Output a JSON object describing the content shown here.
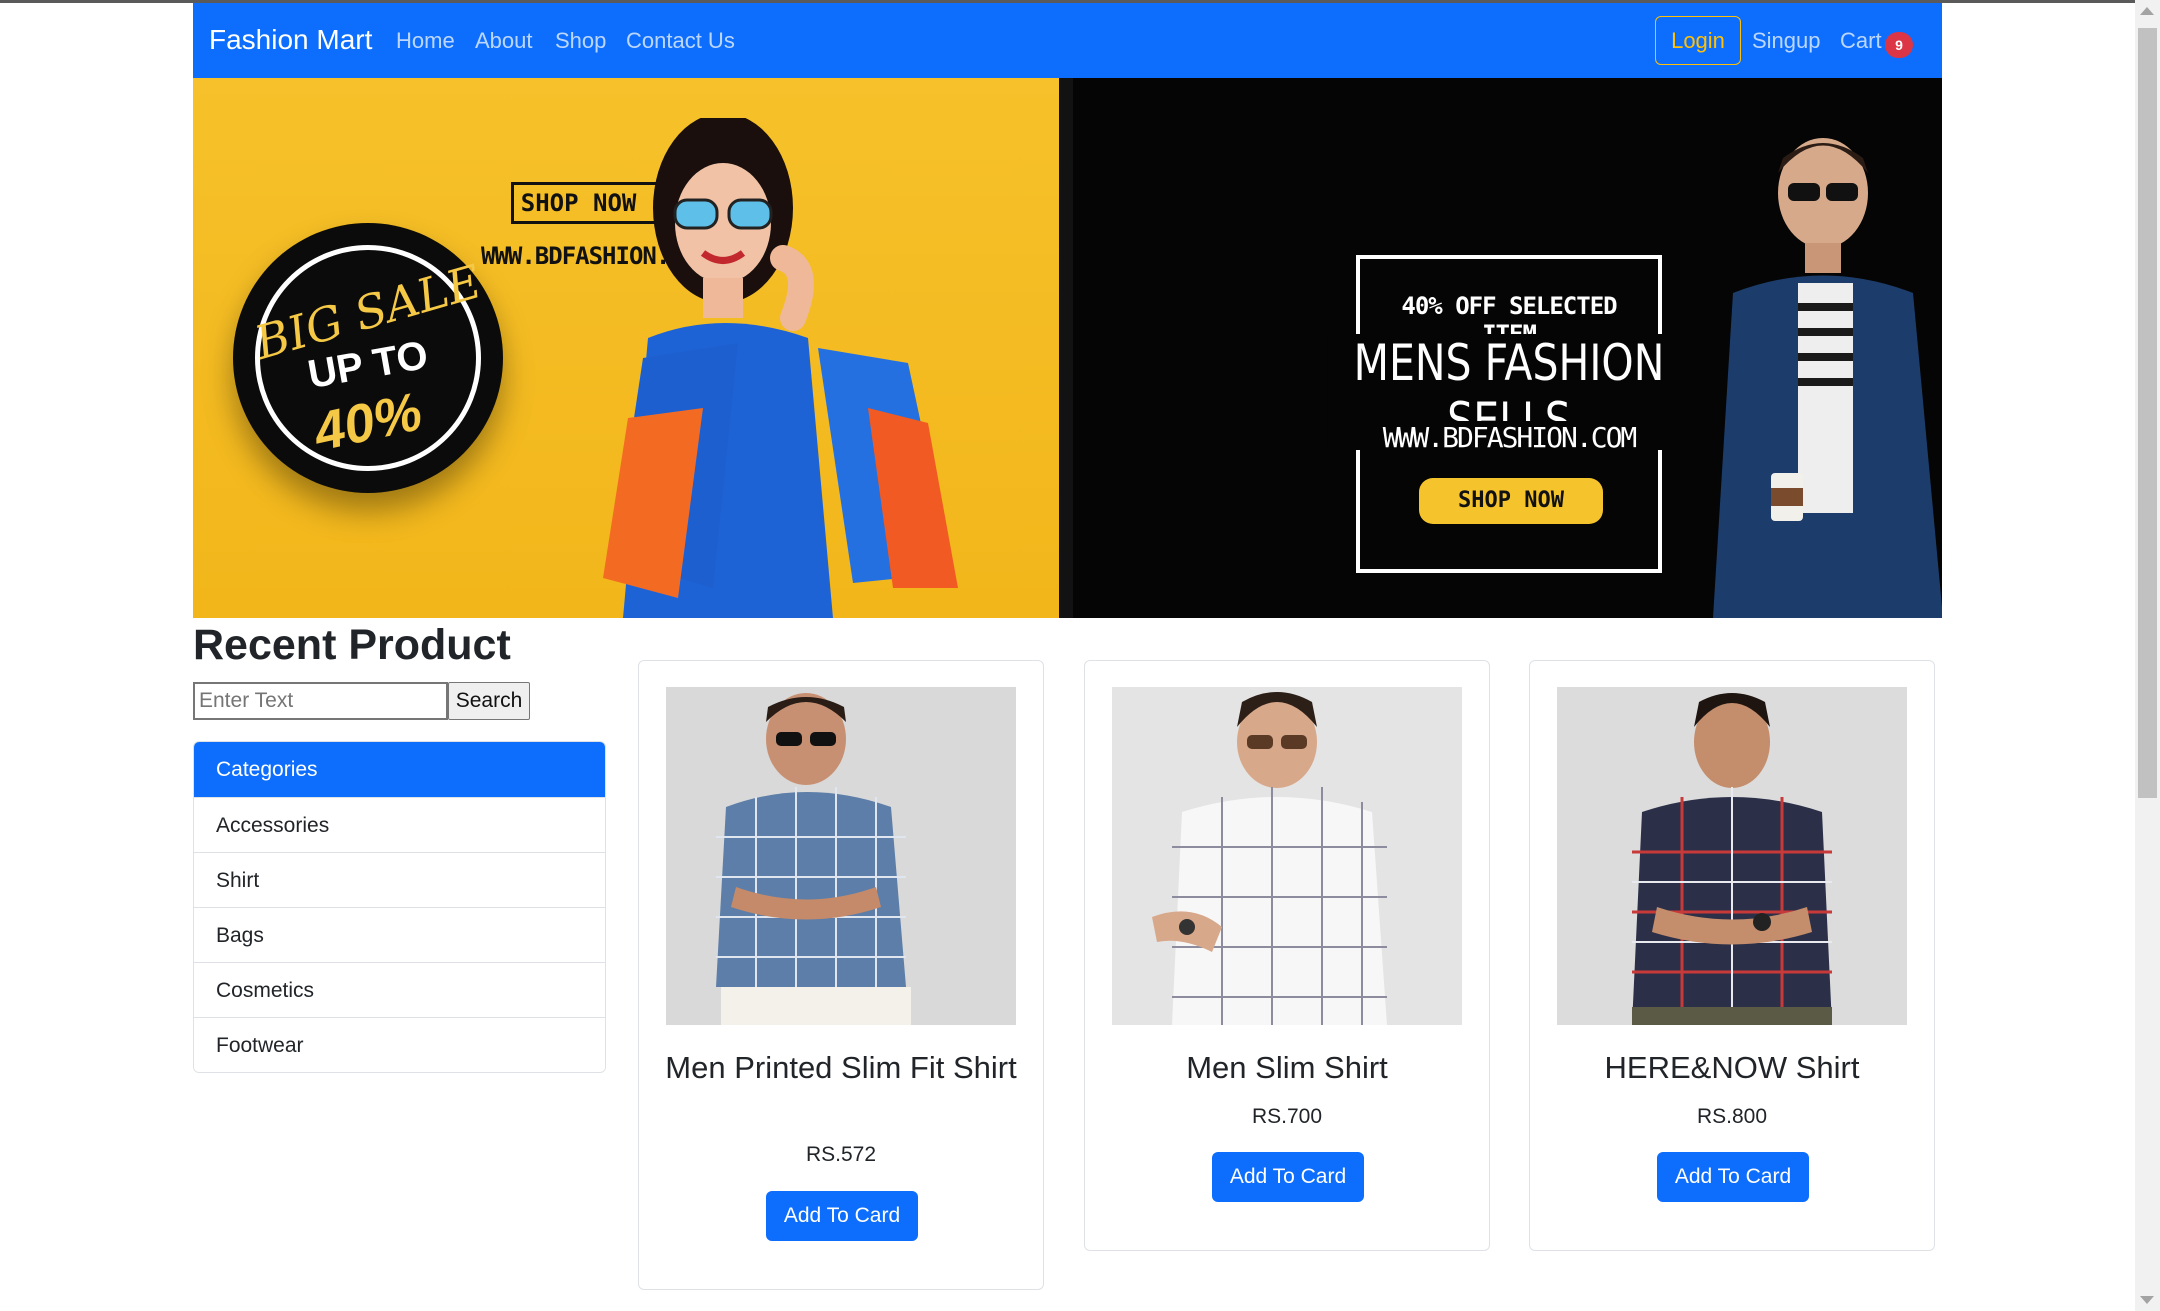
{
  "navbar": {
    "brand": "Fashion Mart",
    "links": [
      "Home",
      "About",
      "Shop",
      "Contact Us"
    ],
    "login": "Login",
    "signup": "Singup",
    "cart": "Cart",
    "cart_count": "9"
  },
  "banner": {
    "left_badge_line1": "BIG SALE",
    "left_badge_line2": "UP TO",
    "left_badge_line3": "40%",
    "left_shop": "SHOP NOW ▸",
    "left_url": "WWW.BDFASHION.COM",
    "right_small": "40% OFF SELECTED ITEM",
    "right_headline": "MENS FASHION SELLS",
    "right_url": "WWW.BDFASHION.COM",
    "right_button": "SHOP NOW"
  },
  "main": {
    "heading": "Recent Product",
    "search_placeholder": "Enter Text",
    "search_button": "Search"
  },
  "categories": {
    "header": "Categories",
    "items": [
      "Accessories",
      "Shirt",
      "Bags",
      "Cosmetics",
      "Footwear"
    ]
  },
  "products": [
    {
      "title": "Men Printed Slim Fit Shirt",
      "price": "RS.572",
      "button": "Add To Card"
    },
    {
      "title": "Men Slim Shirt",
      "price": "RS.700",
      "button": "Add To Card"
    },
    {
      "title": "HERE&NOW Shirt",
      "price": "RS.800",
      "button": "Add To Card"
    }
  ],
  "colors": {
    "primary": "#0d6efd",
    "warning": "#ffc107",
    "danger": "#dc3545",
    "banner_yellow": "#f6c12a",
    "banner_black": "#050505"
  }
}
